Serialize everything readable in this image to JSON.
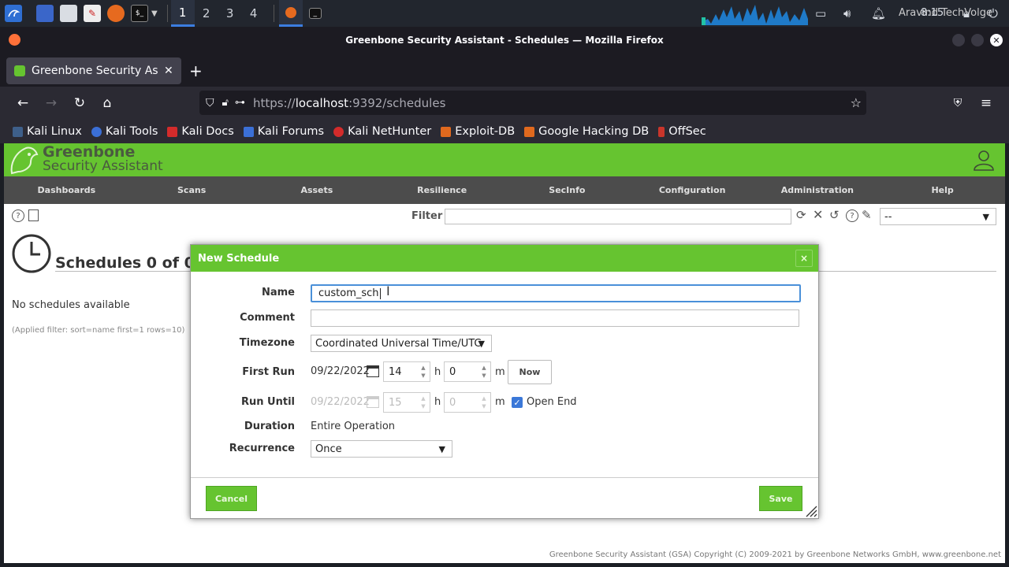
{
  "taskbar": {
    "workspaces": [
      "1",
      "2",
      "3",
      "4"
    ],
    "clock": "8:15",
    "watermark": "Aravind TechVolge"
  },
  "firefox": {
    "window_title": "Greenbone Security Assistant - Schedules — Mozilla Firefox",
    "tab_title": "Greenbone Security Assis",
    "url_prefix": "https://",
    "url_host": "localhost",
    "url_rest": ":9392/schedules",
    "bookmarks": [
      "Kali Linux",
      "Kali Tools",
      "Kali Docs",
      "Kali Forums",
      "Kali NetHunter",
      "Exploit-DB",
      "Google Hacking DB",
      "OffSec"
    ]
  },
  "gsa": {
    "logo_line1": "Greenbone",
    "logo_line2": "Security Assistant",
    "menu": [
      "Dashboards",
      "Scans",
      "Assets",
      "Resilience",
      "SecInfo",
      "Configuration",
      "Administration",
      "Help"
    ],
    "filter_label": "Filter",
    "filter_select": "--",
    "page_title": "Schedules 0 of 0",
    "empty_text": "No schedules available",
    "applied_filter": "(Applied filter: sort=name first=1 rows=10)",
    "footer": "Greenbone Security Assistant (GSA) Copyright (C) 2009-2021 by Greenbone Networks GmbH, www.greenbone.net"
  },
  "dialog": {
    "title": "New Schedule",
    "close_label": "×",
    "name_label": "Name",
    "name_value": "custom_sch",
    "comment_label": "Comment",
    "comment_value": "",
    "timezone_label": "Timezone",
    "timezone_value": "Coordinated Universal Time/UTC",
    "first_run_label": "First Run",
    "first_run_date": "09/22/2022",
    "first_run_hour": "14",
    "first_run_minute": "0",
    "hour_unit": "h",
    "minute_unit": "m",
    "now_label": "Now",
    "run_until_label": "Run Until",
    "run_until_date": "09/22/2022",
    "run_until_hour": "15",
    "run_until_minute": "0",
    "open_end_label": "Open End",
    "open_end_checked": true,
    "duration_label": "Duration",
    "duration_value": "Entire Operation",
    "recurrence_label": "Recurrence",
    "recurrence_value": "Once",
    "cancel_label": "Cancel",
    "save_label": "Save"
  },
  "colors": {
    "gsa_green": "#66c430",
    "menu_gray": "#4c4c4c",
    "firefox_dark": "#1c1b22"
  }
}
